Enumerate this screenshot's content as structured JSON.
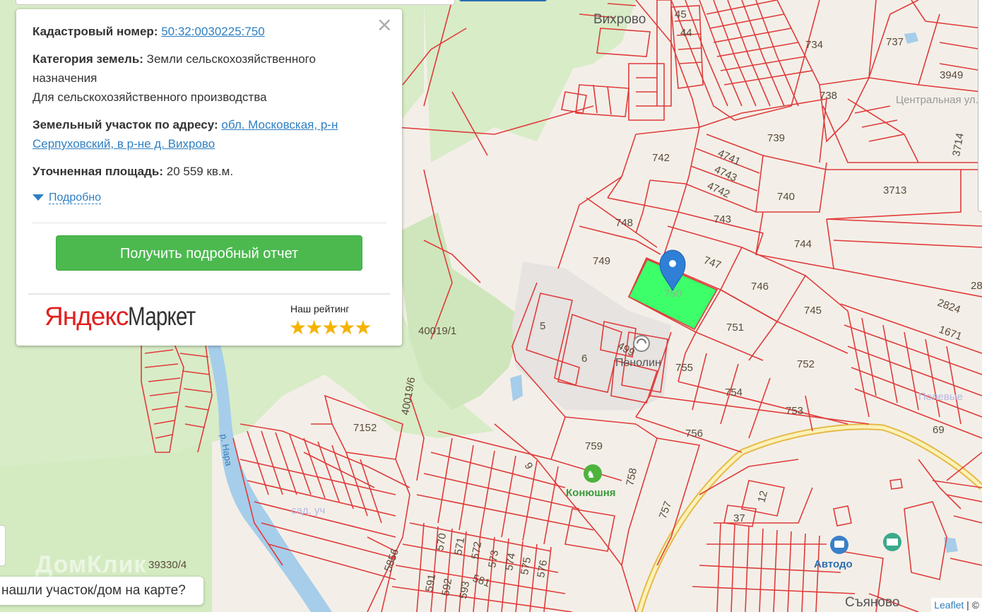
{
  "popup": {
    "close": "×",
    "cad_label": "Кадастровый номер:",
    "cad_value": "50:32:0030225:750",
    "cat_label": "Категория земель:",
    "cat_value": "Земли сельскохозяйственного назначения",
    "usage": "Для сельскохозяйственного производства",
    "addr_label": "Земельный участок по адресу:",
    "addr_value": "обл. Московская, р-н Серпуховский, в р-не д. Вихрово",
    "area_label": "Уточненная площадь:",
    "area_value": "20 559 кв.м.",
    "more": "Подробно",
    "report_button": "Получить подробный отчет",
    "market_logo_1": "Яндекс",
    "market_logo_2": "Маркет",
    "rating_label": "Наш рейтинг",
    "stars": "★★★★★",
    "rating_value": 5
  },
  "chat": "нашли участок/дом на карте?",
  "watermark": "ДомКлик",
  "attribution": {
    "leaflet": "Leaflet",
    "sep": " | ©"
  },
  "map": {
    "place_labels": [
      "Вихрово",
      "Съяново",
      "Пенолин",
      "Конюшня",
      "Автодо",
      "Центральная ул.",
      "Полевые"
    ],
    "river": "р. Нара",
    "parcels": [
      "45",
      "44",
      "734",
      "737",
      "3949",
      "738",
      "742",
      "739",
      "4741",
      "4743",
      "4742",
      "740",
      "3714",
      "3713",
      "748",
      "743",
      "744",
      "749",
      "747",
      "746",
      "750",
      "751",
      "745",
      "5",
      "499",
      "6",
      "755",
      "752",
      "754",
      "753",
      "756",
      "759",
      "758",
      "757",
      "7152",
      "40019/1",
      "40019/6",
      "39330/4",
      "5856",
      "570",
      "571",
      "572",
      "573",
      "574",
      "575",
      "576",
      "591",
      "592",
      "593",
      "581",
      "12",
      "37",
      "2824",
      "1671",
      "69",
      "28",
      "9"
    ],
    "selected_parcel": "750",
    "selected_color": "#3cff6a",
    "boundary_color": "#e03b3b"
  }
}
